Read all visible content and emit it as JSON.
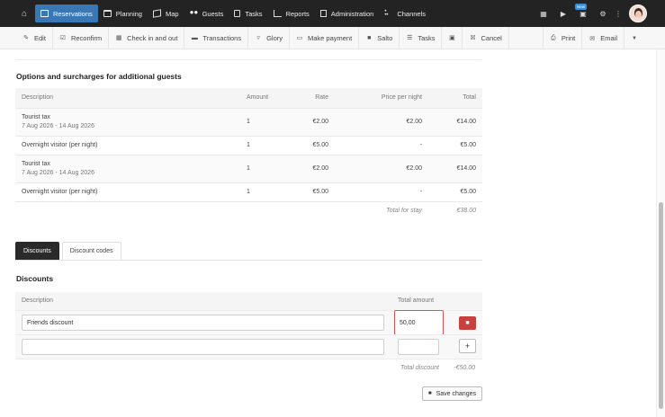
{
  "nav": {
    "home_icon": "home-icon",
    "items": [
      {
        "label": "Reservations",
        "icon": "calendar-book-icon",
        "active": true
      },
      {
        "label": "Planning",
        "icon": "calendar-icon"
      },
      {
        "label": "Map",
        "icon": "map-icon"
      },
      {
        "label": "Guests",
        "icon": "users-icon"
      },
      {
        "label": "Tasks",
        "icon": "clipboard-icon"
      },
      {
        "label": "Reports",
        "icon": "line-chart-icon"
      },
      {
        "label": "Administration",
        "icon": "ledger-icon"
      },
      {
        "label": "Channels",
        "icon": "network-icon"
      }
    ],
    "right_icons": [
      "building-icon",
      "youtube-icon",
      "gift-icon",
      "gear-icon",
      "more-vertical-icon"
    ],
    "badge": "New"
  },
  "toolbar": {
    "left": [
      {
        "label": "Edit",
        "icon": "pencil-icon"
      },
      {
        "label": "Reconfirm",
        "icon": "check-square-icon"
      },
      {
        "label": "Check in and out",
        "icon": "calendar-check-icon"
      },
      {
        "label": "Transactions",
        "icon": "money-icon"
      },
      {
        "label": "Glory",
        "icon": "glory-icon"
      },
      {
        "label": "Make payment",
        "icon": "credit-card-icon"
      },
      {
        "label": "Salto",
        "icon": "lock-icon"
      },
      {
        "label": "Tasks",
        "icon": "tasks-icon"
      },
      {
        "label": "",
        "icon": "car-icon"
      },
      {
        "label": "Cancel",
        "icon": "calendar-x-icon"
      }
    ],
    "right": [
      {
        "label": "Print",
        "icon": "printer-icon"
      },
      {
        "label": "Email",
        "icon": "envelope-icon"
      },
      {
        "label": "",
        "icon": "caret-down-icon"
      }
    ]
  },
  "options": {
    "title": "Options and surcharges for additional guests",
    "headers": {
      "description": "Description",
      "amount": "Amount",
      "rate": "Rate",
      "price_per_night": "Price per night",
      "total": "Total"
    },
    "rows": [
      {
        "description": "Tourist tax",
        "dates": "7 Aug 2026 - 14 Aug 2026",
        "amount": "1",
        "rate": "€2.00",
        "price_per_night": "€2.00",
        "total": "€14.00"
      },
      {
        "description": "Overnight visitor (per night)",
        "dates": "",
        "amount": "1",
        "rate": "€5.00",
        "price_per_night": "-",
        "total": "€5.00"
      },
      {
        "description": "Tourist tax",
        "dates": "7 Aug 2026 - 14 Aug 2026",
        "amount": "1",
        "rate": "€2.00",
        "price_per_night": "€2.00",
        "total": "€14.00"
      },
      {
        "description": "Overnight visitor (per night)",
        "dates": "",
        "amount": "1",
        "rate": "€5.00",
        "price_per_night": "-",
        "total": "€5.00"
      }
    ],
    "total_label": "Total for stay",
    "total_value": "€38.00"
  },
  "tabs": [
    {
      "label": "Discounts",
      "active": true
    },
    {
      "label": "Discount codes",
      "active": false
    }
  ],
  "discounts": {
    "title": "Discounts",
    "headers": {
      "description": "Description",
      "total_amount": "Total amount"
    },
    "rows": [
      {
        "description": "Friends discount",
        "amount": "50,00"
      },
      {
        "description": "",
        "amount": ""
      }
    ],
    "total_label": "Total discount",
    "total_value": "-€50.00",
    "save_label": "Save changes"
  }
}
